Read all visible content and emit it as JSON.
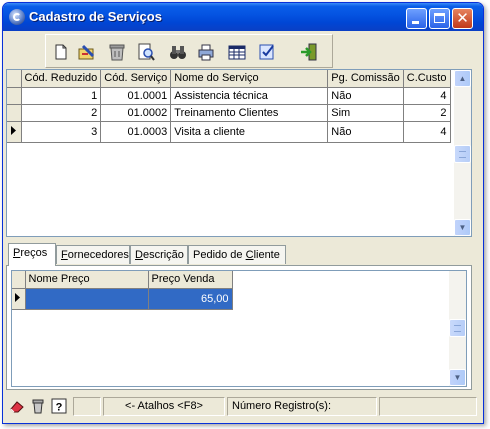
{
  "window": {
    "title": "Cadastro de Serviços"
  },
  "toolbar": {
    "tools": [
      "new-document-icon",
      "edit-icon",
      "delete-icon",
      "preview-icon",
      "search-binoculars-icon",
      "print-icon",
      "grid-view-icon",
      "confirm-icon",
      "exit-icon"
    ]
  },
  "services_grid": {
    "columns": [
      "Cód. Reduzido",
      "Cód. Serviço",
      "Nome do Serviço",
      "Pg. Comissão",
      "C.Custo"
    ],
    "rows": [
      [
        "1",
        "01.0001",
        "Assistencia técnica",
        "Não",
        "4"
      ],
      [
        "2",
        "01.0002",
        "Treinamento Clientes",
        "Sim",
        "2"
      ],
      [
        "3",
        "01.0003",
        "Visita a cliente",
        "Não",
        "4"
      ]
    ],
    "current_row": 3
  },
  "tabs": [
    {
      "label": "Preços",
      "hotkey": "P",
      "active": true
    },
    {
      "label": "Fornecedores",
      "hotkey": "F",
      "active": false
    },
    {
      "label": "Descrição",
      "hotkey": "D",
      "active": false
    },
    {
      "label": "Pedido de Cliente",
      "hotkey": "C",
      "active": false
    }
  ],
  "prices_grid": {
    "columns": [
      "Nome Preço",
      "Preço Venda"
    ],
    "rows": [
      [
        "",
        "65,00"
      ]
    ]
  },
  "statusbar": {
    "shortcut_text": "<- Atalhos <F8>",
    "record_label": "Número Registro(s):",
    "record_value": ""
  },
  "colors": {
    "title_bar": "#0054e3",
    "selection": "#316ac5",
    "face": "#ece9d8"
  }
}
